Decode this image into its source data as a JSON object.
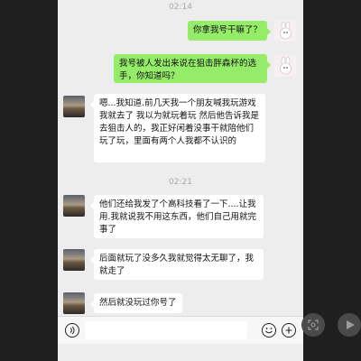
{
  "timestamps": [
    "02:14",
    "02:21"
  ],
  "messages": [
    {
      "side": "right",
      "text": "你拿我号干嘛了？"
    },
    {
      "side": "right",
      "text": "我号被人发出来说在狙击胖森杯的选手，你知道吗？"
    },
    {
      "side": "left",
      "text": "嗯...我知道.前几天我一个朋友喊我玩游戏我就去了 我以为就玩着玩 然后他告诉我是去狙击人的，我正好闲着没事干就陪他们玩了玩，里面有两个人我都不认识的"
    },
    {
      "side": "left",
      "text": "他们还给我发了个高科技看了一下....让我用.我就说我不用这东西，他们自己用就完事了"
    },
    {
      "side": "left",
      "text": "后面就玩了没多久我就觉得太无聊了，我就走了"
    },
    {
      "side": "left",
      "text": "然后就没玩过你号了"
    }
  ],
  "icons": {
    "voice": "voice-icon",
    "emoji": "emoji-icon",
    "plus": "plus-icon",
    "scan": "scan-icon",
    "play": "play-icon"
  },
  "colors": {
    "sent_bubble": "#95ec69",
    "received_bubble": "#ffffff",
    "chat_background": "#ededed"
  }
}
